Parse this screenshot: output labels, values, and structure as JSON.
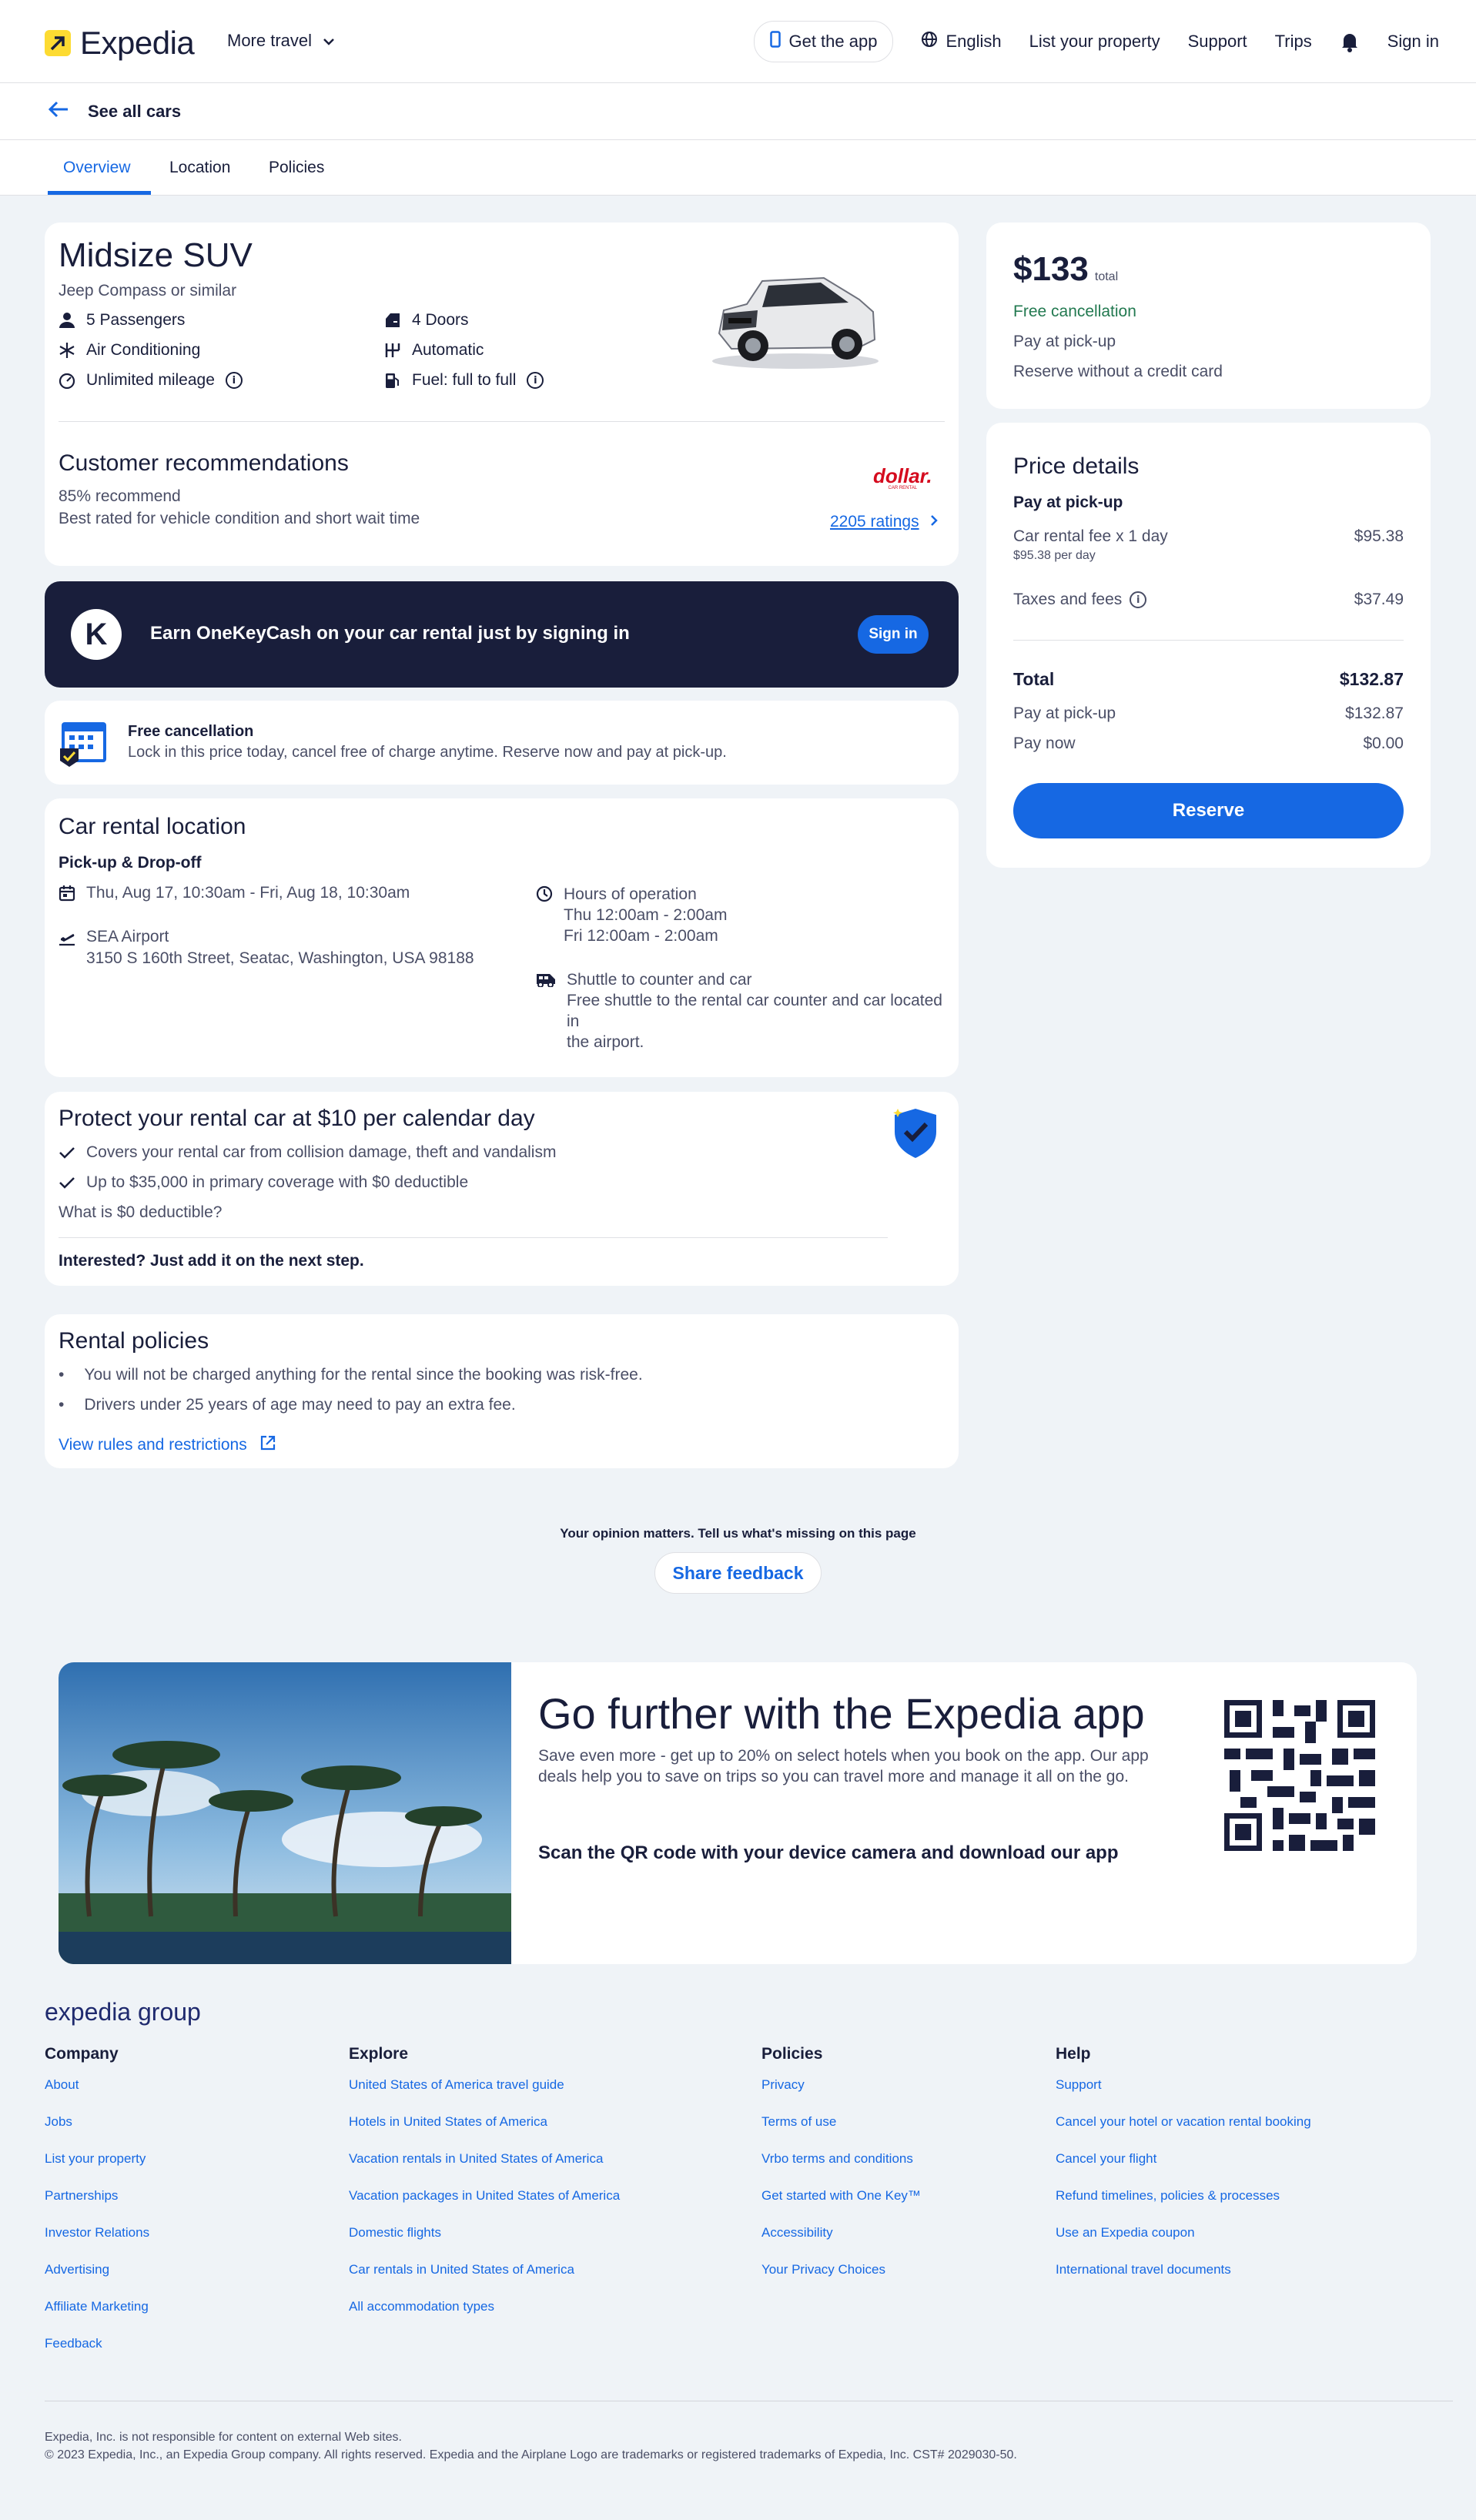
{
  "header": {
    "brand": "Expedia",
    "more_travel": "More travel",
    "get_app": "Get the app",
    "language": "English",
    "list_property": "List your property",
    "support": "Support",
    "trips": "Trips",
    "sign_in": "Sign in"
  },
  "back_link": "See all cars",
  "tabs": [
    "Overview",
    "Location",
    "Policies"
  ],
  "car": {
    "category": "Midsize SUV",
    "model": "Jeep Compass or similar",
    "features_left": [
      "5 Passengers",
      "Air Conditioning",
      "Unlimited mileage"
    ],
    "features_right": [
      "4 Doors",
      "Automatic",
      "Fuel: full to full"
    ],
    "recommend_title": "Customer recommendations",
    "recommend_pct": "85% recommend",
    "recommend_note": "Best rated for vehicle condition and short wait time",
    "ratings_link": "2205 ratings",
    "vendor_logo": "dollar.",
    "vendor_sub": "CAR RENTAL"
  },
  "onekey": {
    "text": "Earn OneKeyCash on your car rental just by signing in",
    "button": "Sign in",
    "logo": "K"
  },
  "free_cancel": {
    "title": "Free cancellation",
    "text": "Lock in this price today, cancel free of charge anytime. Reserve now and pay at pick-up."
  },
  "location": {
    "title": "Car rental location",
    "subtitle": "Pick-up & Drop-off",
    "dates": "Thu, Aug 17, 10:30am - Fri, Aug 18, 10:30am",
    "place": "SEA Airport",
    "address": "3150 S 160th Street, Seatac, Washington, USA 98188",
    "hours_title": "Hours of operation",
    "hours_1": "Thu 12:00am - 2:00am",
    "hours_2": "Fri 12:00am - 2:00am",
    "shuttle_title": "Shuttle to counter and car",
    "shuttle_text_1": "Free shuttle to the rental car counter and car located in",
    "shuttle_text_2": "the airport."
  },
  "protect": {
    "title": "Protect your rental car at $10 per calendar day",
    "item1": "Covers your rental car from collision damage, theft and vandalism",
    "item2": "Up to $35,000 in primary coverage with $0 deductible",
    "question": "What is $0 deductible?",
    "note": "Interested? Just add it on the next step."
  },
  "policies": {
    "title": "Rental policies",
    "item1": "You will not be charged anything for the rental since the booking was risk-free.",
    "item2": "Drivers under 25 years of age may need to pay an extra fee.",
    "link": "View rules and restrictions"
  },
  "summary": {
    "price": "$133",
    "price_suffix": "total",
    "free_cancel": "Free cancellation",
    "pay_pickup": "Pay at pick-up",
    "no_card": "Reserve without a credit card"
  },
  "price_details": {
    "title": "Price details",
    "section": "Pay at pick-up",
    "fee_label": "Car rental fee x 1 day",
    "fee_sub": "$95.38 per day",
    "fee_value": "$95.38",
    "tax_label": "Taxes and fees",
    "tax_value": "$37.49",
    "total_label": "Total",
    "total_value": "$132.87",
    "pickup_label": "Pay at pick-up",
    "pickup_value": "$132.87",
    "now_label": "Pay now",
    "now_value": "$0.00",
    "reserve": "Reserve"
  },
  "feedback": {
    "prompt": "Your opinion matters. Tell us what's missing on this page",
    "button": "Share feedback"
  },
  "app_promo": {
    "title": "Go further with the Expedia app",
    "text_1": "Save even more - get up to 20% on select hotels when you book on the app. Our app",
    "text_2": "deals help you to save on trips so you can travel more and manage it all on the go.",
    "qr_note": "Scan the QR code with your device camera and download our app"
  },
  "footer": {
    "brand": "expedia group",
    "columns": [
      {
        "title": "Company",
        "links": [
          "About",
          "Jobs",
          "List your property",
          "Partnerships",
          "Investor Relations",
          "Advertising",
          "Affiliate Marketing",
          "Feedback"
        ]
      },
      {
        "title": "Explore",
        "links": [
          "United States of America travel guide",
          "Hotels in United States of America",
          "Vacation rentals in United States of America",
          "Vacation packages in United States of America",
          "Domestic flights",
          "Car rentals in United States of America",
          "All accommodation types"
        ]
      },
      {
        "title": "Policies",
        "links": [
          "Privacy",
          "Terms of use",
          "Vrbo terms and conditions",
          "Get started with One Key™",
          "Accessibility",
          "Your Privacy Choices"
        ]
      },
      {
        "title": "Help",
        "links": [
          "Support",
          "Cancel your hotel or vacation rental booking",
          "Cancel your flight",
          "Refund timelines, policies & processes",
          "Use an Expedia coupon",
          "International travel documents"
        ]
      }
    ],
    "legal_1": "Expedia, Inc. is not responsible for content on external Web sites.",
    "legal_2": "© 2023 Expedia, Inc., an Expedia Group company. All rights reserved. Expedia and the Airplane Logo are trademarks or registered trademarks of Expedia, Inc. CST# 2029030-50."
  },
  "colors": {
    "accent": "#1668e3",
    "navy": "#191e3b",
    "green": "#227950",
    "brand_yellow": "#fddb32"
  }
}
